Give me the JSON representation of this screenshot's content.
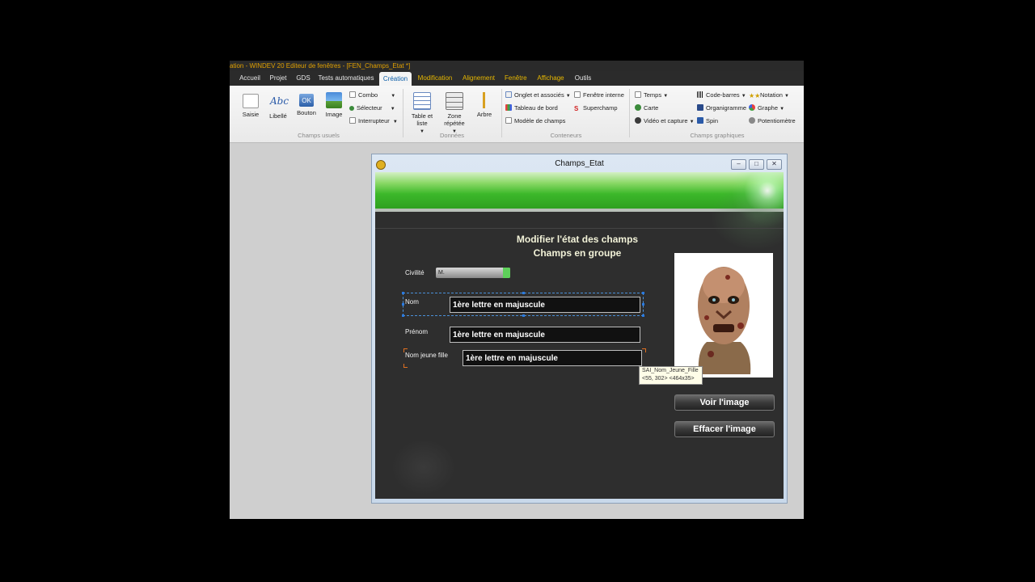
{
  "titlebar": {
    "text": "ation - WINDEV 20  Editeur de fenêtres - [FEN_Champs_Etat *]"
  },
  "ribbon_tabs": [
    {
      "label": "Accueil"
    },
    {
      "label": "Projet"
    },
    {
      "label": "GDS"
    },
    {
      "label": "Tests automatiques"
    },
    {
      "label": "Création"
    },
    {
      "label": "Modification"
    },
    {
      "label": "Alignement"
    },
    {
      "label": "Fenêtre"
    },
    {
      "label": "Affichage"
    },
    {
      "label": "Outils"
    }
  ],
  "ribbon": {
    "usual": {
      "saisie": "Saisie",
      "libelle": "Libellé",
      "bouton": "Bouton",
      "image": "Image",
      "combo": "Combo",
      "selecteur": "Sélecteur",
      "interrupteur": "Interrupteur",
      "group": "Champs usuels",
      "libelle_icon_text": "Abc",
      "bouton_icon_text": "OK"
    },
    "data": {
      "table": "Table et liste",
      "zone": "Zone répétée",
      "arbre": "Arbre",
      "group": "Données"
    },
    "containers": {
      "onglet": "Onglet et associés",
      "tableau": "Tableau de bord",
      "modele": "Modèle de champs",
      "fenetre": "Fenêtre interne",
      "superchamp": "Superchamp",
      "group": "Conteneurs"
    },
    "graphic": {
      "temps": "Temps",
      "carte": "Carte",
      "video": "Vidéo et capture",
      "code": "Code-barres",
      "organigramme": "Organigramme",
      "spin": "Spin",
      "notation": "Notation",
      "graphe": "Graphe",
      "potentiometre": "Potentiomètre",
      "group": "Champs graphiques"
    }
  },
  "window": {
    "title": "Champs_Etat",
    "heading1": "Modifier l'état des champs",
    "heading2": "Champs en groupe",
    "civilite_label": "Civilité",
    "civilite_value": "M.",
    "nom_label": "Nom",
    "nom_value": "1ère lettre en majuscule",
    "prenom_label": "Prénom",
    "prenom_value": "1ère lettre en majuscule",
    "njf_label": "Nom jeune fille",
    "njf_value": "1ère lettre en majuscule",
    "btn_voir": "Voir l'image",
    "btn_effacer": "Effacer l'image"
  },
  "tooltip": {
    "line1": "SAI_Nom_Jeune_Fille",
    "line2": "<55, 302> <464x35>"
  },
  "colors": {
    "accent": "#0a5da8",
    "tab_gold": "#e8b800",
    "banner_green": "#3cb82a"
  }
}
